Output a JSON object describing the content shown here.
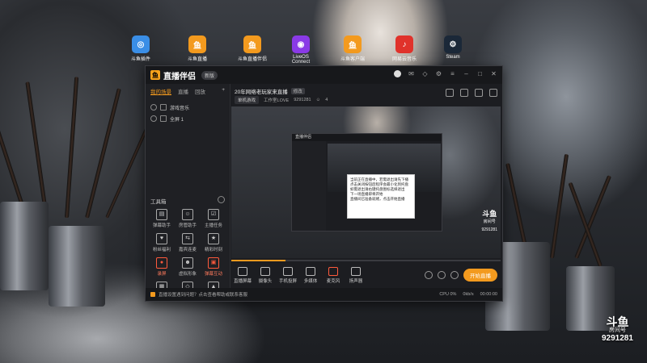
{
  "desktop_icons": [
    {
      "label": "斗鱼插件",
      "color": "#3a8ee6",
      "glyph": "◎",
      "icon": "app-icon"
    },
    {
      "label": "斗鱼直播",
      "color": "#f39a1e",
      "glyph": "鱼",
      "icon": "douyu-icon"
    },
    {
      "label": "斗鱼直播伴侣",
      "color": "#f39a1e",
      "glyph": "鱼",
      "icon": "douyu-icon"
    },
    {
      "label": "LiveOS Connect",
      "color": "#8a3ae6",
      "glyph": "◉",
      "icon": "liveos-icon"
    },
    {
      "label": "斗鱼客户端",
      "color": "#f39a1e",
      "glyph": "鱼",
      "icon": "douyu-icon"
    },
    {
      "label": "网易云音乐",
      "color": "#e0322b",
      "glyph": "♪",
      "icon": "netease-music-icon"
    },
    {
      "label": "Steam",
      "color": "#1b2838",
      "glyph": "⚙",
      "icon": "steam-icon"
    }
  ],
  "app": {
    "name": "直播伴侣",
    "version": "新版",
    "tabs": [
      {
        "label": "我的场景",
        "active": true
      },
      {
        "label": "直播",
        "active": false
      },
      {
        "label": "回放",
        "active": false
      }
    ],
    "add_tab": "+",
    "scenes": [
      "游戏音乐",
      "全屏 1"
    ],
    "tools_title": "工具箱",
    "tools": [
      {
        "label": "弹幕助手",
        "glyph": "▤",
        "icon": "danmaku-icon"
      },
      {
        "label": "房管助手",
        "glyph": "☺",
        "icon": "admin-icon"
      },
      {
        "label": "主播任务",
        "glyph": "☑",
        "icon": "task-icon"
      },
      {
        "label": "粉丝福利",
        "glyph": "♥",
        "icon": "fans-icon"
      },
      {
        "label": "嘉宾连麦",
        "glyph": "⇆",
        "icon": "connect-icon"
      },
      {
        "label": "精彩时刻",
        "glyph": "★",
        "icon": "highlight-icon"
      },
      {
        "label": "录屏",
        "glyph": "●",
        "icon": "record-icon",
        "highlight": true
      },
      {
        "label": "虚拟形象",
        "glyph": "☻",
        "icon": "avatar-icon"
      },
      {
        "label": "弹幕互动",
        "glyph": "▣",
        "icon": "interact-icon",
        "highlight": true
      },
      {
        "label": "",
        "glyph": "▦",
        "icon": "more-icon"
      },
      {
        "label": "",
        "glyph": "◇",
        "icon": "gift-icon"
      },
      {
        "label": "",
        "glyph": "▲",
        "icon": "upload-icon"
      }
    ],
    "stream": {
      "title": "20年网络老玩家来直播",
      "edit_label": "修改",
      "category": "单机游戏",
      "room_label": "工作室LOVE",
      "room_id": "9291281",
      "viewers": "4"
    },
    "preview": {
      "nested_title": "直播伴侣",
      "tooltip_lines": [
        "当前正在直播中，若需退出请先下播",
        "点击关闭按钮后程序会最小化到托盘",
        "如需退出请右键托盘图标选择退出",
        "下一场直播即将开始",
        "直播间已准备就绪，点击开始直播"
      ],
      "watermark_top": "斗鱼",
      "watermark_mid": "房间号",
      "watermark_bottom": "9291281"
    },
    "progress": 0.2,
    "controls": [
      {
        "label": "直播屏幕",
        "icon": "screen-icon"
      },
      {
        "label": "摄像头",
        "icon": "camera-icon"
      },
      {
        "label": "手机投屏",
        "icon": "phone-icon"
      },
      {
        "label": "多媒体",
        "icon": "media-icon"
      },
      {
        "label": "麦克风",
        "icon": "microphone-icon",
        "mic": true
      },
      {
        "label": "扬声器",
        "icon": "speaker-icon"
      }
    ],
    "go_live": "开始直播",
    "status_tip": "直播设置遇到问题？点击查看帮助或联系客服",
    "status_stats": [
      "CPU 0%",
      "0kb/s",
      "00:00:00"
    ]
  },
  "bottom_watermark": {
    "line1": "斗鱼",
    "line2": "房间号",
    "line3": "9291281"
  }
}
